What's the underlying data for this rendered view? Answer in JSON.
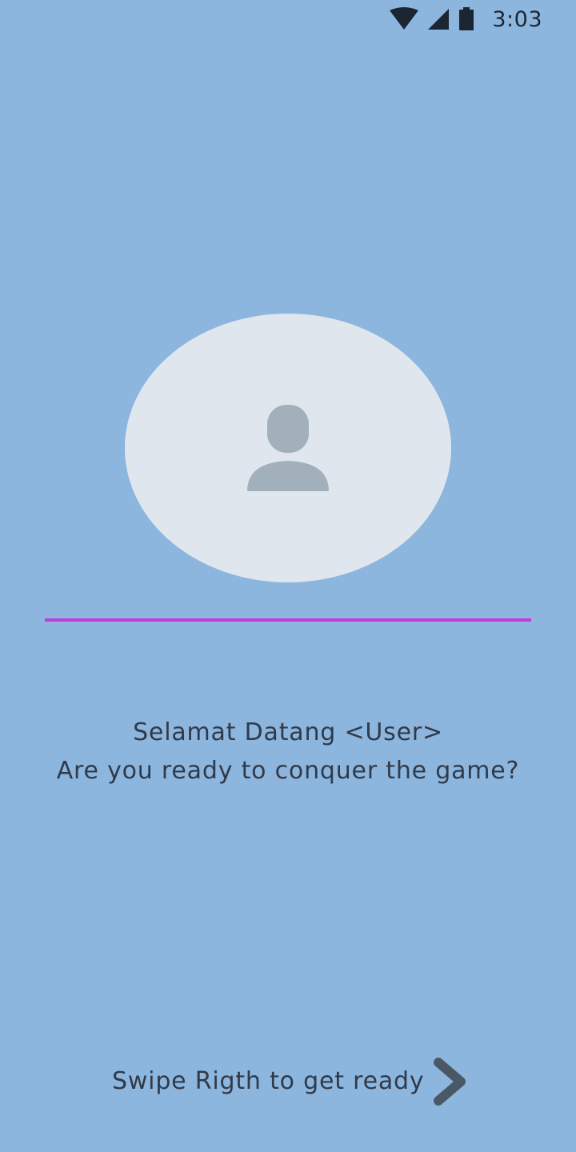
{
  "status_bar": {
    "time": "3:03",
    "icons": [
      "wifi-icon",
      "cellular-signal-icon",
      "battery-icon"
    ]
  },
  "welcome": {
    "line1": "Selamat Datang <User>",
    "line2": "Are you ready to conquer the game?"
  },
  "swipe": {
    "label": "Swipe Rigth to get ready",
    "icon": "chevron-right-icon"
  },
  "colors": {
    "background": "#8db6de",
    "avatar_bg": "#e0e6ee",
    "avatar_icon": "#a2b0bb",
    "divider": "#c13bd6",
    "text": "#2f3a4a",
    "arrow": "#4a5866"
  }
}
